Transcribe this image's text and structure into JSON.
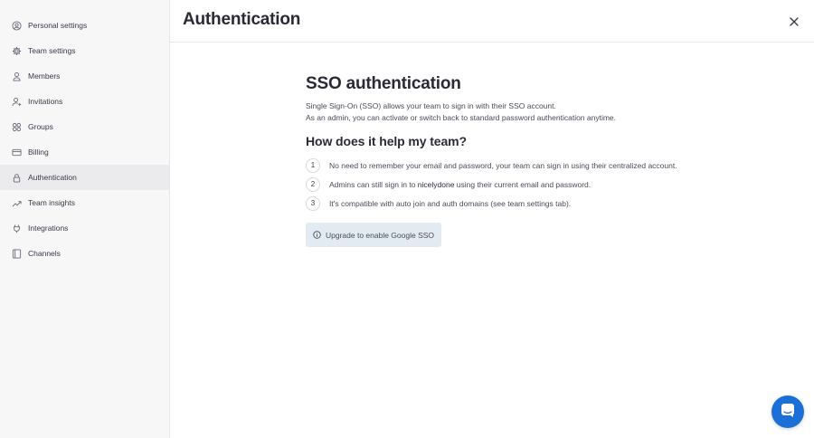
{
  "sidebar": {
    "items": [
      {
        "label": "Personal settings",
        "icon": "user-circle-icon"
      },
      {
        "label": "Team settings",
        "icon": "gear-icon"
      },
      {
        "label": "Members",
        "icon": "user-icon"
      },
      {
        "label": "Invitations",
        "icon": "user-plus-icon"
      },
      {
        "label": "Groups",
        "icon": "groups-icon"
      },
      {
        "label": "Billing",
        "icon": "credit-card-icon"
      },
      {
        "label": "Authentication",
        "icon": "lock-icon",
        "active": true
      },
      {
        "label": "Team insights",
        "icon": "trend-icon"
      },
      {
        "label": "Integrations",
        "icon": "plug-icon"
      },
      {
        "label": "Channels",
        "icon": "book-icon"
      }
    ]
  },
  "header": {
    "title": "Authentication",
    "close_icon": "close-icon"
  },
  "main": {
    "sso_title": "SSO authentication",
    "description_line1": "Single Sign-On (SSO) allows your team to sign in with their SSO account.",
    "description_line2": "As an admin, you can activate or switch back to standard password authentication anytime.",
    "help_title": "How does it help my team?",
    "steps": [
      {
        "number": "1",
        "text": "No need to remember your email and password, your team can sign in using their centralized account."
      },
      {
        "number": "2",
        "text_before": "Admins can still sign in to ",
        "brand": "nicelydone",
        "text_after": " using their current email and password."
      },
      {
        "number": "3",
        "text": "It's compatible with auto join and auth domains (see team settings tab)."
      }
    ],
    "upgrade_button": "Upgrade to enable Google SSO"
  },
  "colors": {
    "accent": "#1b6fd6",
    "sidebar_bg": "#f7f7f8",
    "active_item_bg": "#ebebee",
    "upgrade_bg": "#e3ebf2"
  }
}
